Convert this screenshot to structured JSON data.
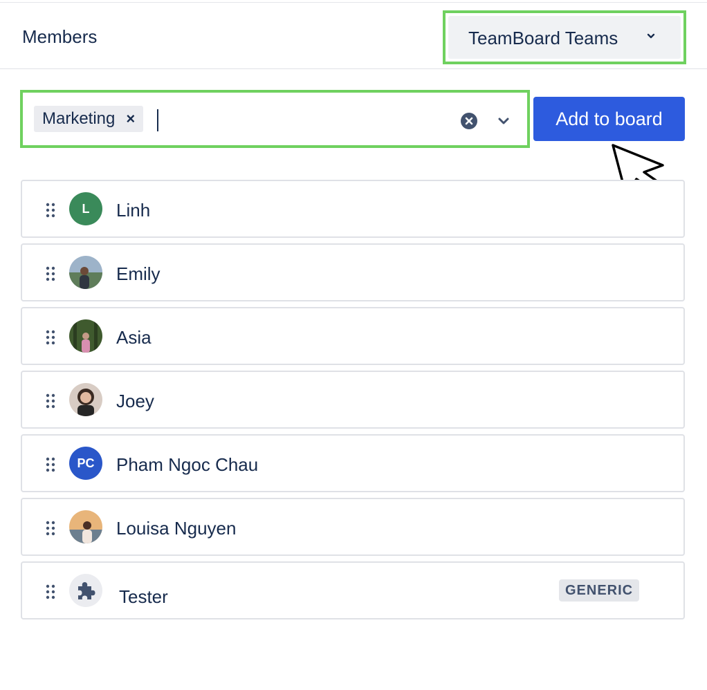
{
  "header": {
    "title": "Members"
  },
  "team_select": {
    "value": "TeamBoard Teams"
  },
  "filter": {
    "chip_label": "Marketing",
    "chip_remove": "×"
  },
  "add_button": {
    "label": "Add to board"
  },
  "members": [
    {
      "name": "Linh",
      "initials": "L",
      "avatar_color": "#3a8a5a"
    },
    {
      "name": "Emily"
    },
    {
      "name": "Asia"
    },
    {
      "name": "Joey"
    },
    {
      "name": "Pham Ngoc Chau",
      "initials": "PC",
      "avatar_color": "#2a57c9"
    },
    {
      "name": "Louisa Nguyen"
    },
    {
      "name": "Tester",
      "badge": "GENERIC"
    }
  ],
  "colors": {
    "accent": "#2d5bde",
    "highlight": "#6fd15f"
  }
}
